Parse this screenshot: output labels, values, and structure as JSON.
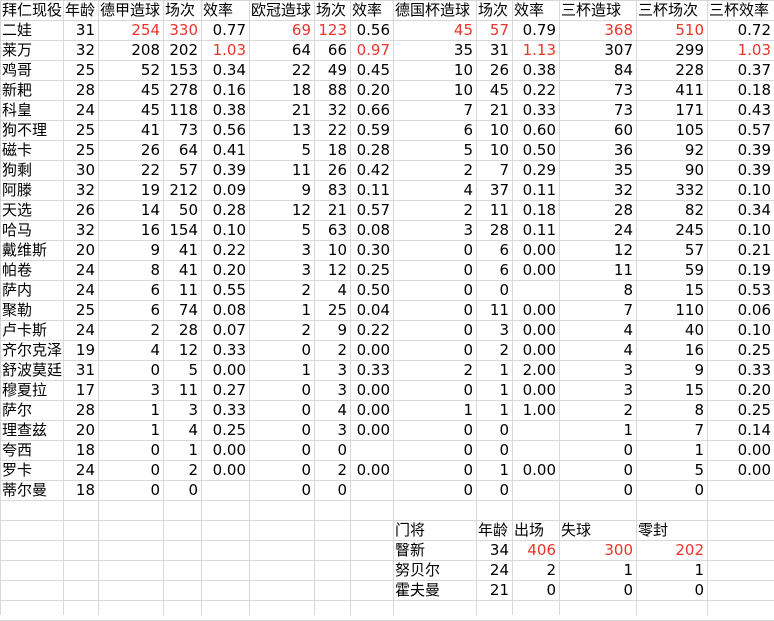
{
  "colors": {
    "highlight": "#e8352b",
    "grid": "#d8d8d8"
  },
  "header": [
    "拜仁现役",
    "年龄",
    "德甲造球",
    "场次",
    "效率",
    "欧冠造球",
    "场次",
    "效率",
    "德国杯造球",
    "场次",
    "效率",
    "三杯造球",
    "三杯场次",
    "三杯效率"
  ],
  "rows": [
    {
      "name": "二娃",
      "age": "31",
      "bl_g": "254",
      "bl_m": "330",
      "bl_e": "0.77",
      "cl_g": "69",
      "cl_m": "123",
      "cl_e": "0.56",
      "dfb_g": "45",
      "dfb_m": "57",
      "dfb_e": "0.79",
      "t_g": "368",
      "t_m": "510",
      "t_e": "0.72"
    },
    {
      "name": "莱万",
      "age": "32",
      "bl_g": "208",
      "bl_m": "202",
      "bl_e": "1.03",
      "cl_g": "64",
      "cl_m": "66",
      "cl_e": "0.97",
      "dfb_g": "35",
      "dfb_m": "31",
      "dfb_e": "1.13",
      "t_g": "307",
      "t_m": "299",
      "t_e": "1.03"
    },
    {
      "name": "鸡哥",
      "age": "25",
      "bl_g": "52",
      "bl_m": "153",
      "bl_e": "0.34",
      "cl_g": "22",
      "cl_m": "49",
      "cl_e": "0.45",
      "dfb_g": "10",
      "dfb_m": "26",
      "dfb_e": "0.38",
      "t_g": "84",
      "t_m": "228",
      "t_e": "0.37"
    },
    {
      "name": "新耙",
      "age": "28",
      "bl_g": "45",
      "bl_m": "278",
      "bl_e": "0.16",
      "cl_g": "18",
      "cl_m": "88",
      "cl_e": "0.20",
      "dfb_g": "10",
      "dfb_m": "45",
      "dfb_e": "0.22",
      "t_g": "73",
      "t_m": "411",
      "t_e": "0.18"
    },
    {
      "name": "科皇",
      "age": "24",
      "bl_g": "45",
      "bl_m": "118",
      "bl_e": "0.38",
      "cl_g": "21",
      "cl_m": "32",
      "cl_e": "0.66",
      "dfb_g": "7",
      "dfb_m": "21",
      "dfb_e": "0.33",
      "t_g": "73",
      "t_m": "171",
      "t_e": "0.43"
    },
    {
      "name": "狗不理",
      "age": "25",
      "bl_g": "41",
      "bl_m": "73",
      "bl_e": "0.56",
      "cl_g": "13",
      "cl_m": "22",
      "cl_e": "0.59",
      "dfb_g": "6",
      "dfb_m": "10",
      "dfb_e": "0.60",
      "t_g": "60",
      "t_m": "105",
      "t_e": "0.57"
    },
    {
      "name": "磁卡",
      "age": "25",
      "bl_g": "26",
      "bl_m": "64",
      "bl_e": "0.41",
      "cl_g": "5",
      "cl_m": "18",
      "cl_e": "0.28",
      "dfb_g": "5",
      "dfb_m": "10",
      "dfb_e": "0.50",
      "t_g": "36",
      "t_m": "92",
      "t_e": "0.39"
    },
    {
      "name": "狗剩",
      "age": "30",
      "bl_g": "22",
      "bl_m": "57",
      "bl_e": "0.39",
      "cl_g": "11",
      "cl_m": "26",
      "cl_e": "0.42",
      "dfb_g": "2",
      "dfb_m": "7",
      "dfb_e": "0.29",
      "t_g": "35",
      "t_m": "90",
      "t_e": "0.39"
    },
    {
      "name": "阿滕",
      "age": "32",
      "bl_g": "19",
      "bl_m": "212",
      "bl_e": "0.09",
      "cl_g": "9",
      "cl_m": "83",
      "cl_e": "0.11",
      "dfb_g": "4",
      "dfb_m": "37",
      "dfb_e": "0.11",
      "t_g": "32",
      "t_m": "332",
      "t_e": "0.10"
    },
    {
      "name": "天选",
      "age": "26",
      "bl_g": "14",
      "bl_m": "50",
      "bl_e": "0.28",
      "cl_g": "12",
      "cl_m": "21",
      "cl_e": "0.57",
      "dfb_g": "2",
      "dfb_m": "11",
      "dfb_e": "0.18",
      "t_g": "28",
      "t_m": "82",
      "t_e": "0.34"
    },
    {
      "name": "哈马",
      "age": "32",
      "bl_g": "16",
      "bl_m": "154",
      "bl_e": "0.10",
      "cl_g": "5",
      "cl_m": "63",
      "cl_e": "0.08",
      "dfb_g": "3",
      "dfb_m": "28",
      "dfb_e": "0.11",
      "t_g": "24",
      "t_m": "245",
      "t_e": "0.10"
    },
    {
      "name": "戴维斯",
      "age": "20",
      "bl_g": "9",
      "bl_m": "41",
      "bl_e": "0.22",
      "cl_g": "3",
      "cl_m": "10",
      "cl_e": "0.30",
      "dfb_g": "0",
      "dfb_m": "6",
      "dfb_e": "0.00",
      "t_g": "12",
      "t_m": "57",
      "t_e": "0.21"
    },
    {
      "name": "帕卷",
      "age": "24",
      "bl_g": "8",
      "bl_m": "41",
      "bl_e": "0.20",
      "cl_g": "3",
      "cl_m": "12",
      "cl_e": "0.25",
      "dfb_g": "0",
      "dfb_m": "6",
      "dfb_e": "0.00",
      "t_g": "11",
      "t_m": "59",
      "t_e": "0.19"
    },
    {
      "name": "萨内",
      "age": "24",
      "bl_g": "6",
      "bl_m": "11",
      "bl_e": "0.55",
      "cl_g": "2",
      "cl_m": "4",
      "cl_e": "0.50",
      "dfb_g": "0",
      "dfb_m": "0",
      "dfb_e": "",
      "t_g": "8",
      "t_m": "15",
      "t_e": "0.53"
    },
    {
      "name": "聚勒",
      "age": "25",
      "bl_g": "6",
      "bl_m": "74",
      "bl_e": "0.08",
      "cl_g": "1",
      "cl_m": "25",
      "cl_e": "0.04",
      "dfb_g": "0",
      "dfb_m": "11",
      "dfb_e": "0.00",
      "t_g": "7",
      "t_m": "110",
      "t_e": "0.06"
    },
    {
      "name": "卢卡斯",
      "age": "24",
      "bl_g": "2",
      "bl_m": "28",
      "bl_e": "0.07",
      "cl_g": "2",
      "cl_m": "9",
      "cl_e": "0.22",
      "dfb_g": "0",
      "dfb_m": "3",
      "dfb_e": "0.00",
      "t_g": "4",
      "t_m": "40",
      "t_e": "0.10"
    },
    {
      "name": "齐尔克泽",
      "age": "19",
      "bl_g": "4",
      "bl_m": "12",
      "bl_e": "0.33",
      "cl_g": "0",
      "cl_m": "2",
      "cl_e": "0.00",
      "dfb_g": "0",
      "dfb_m": "2",
      "dfb_e": "0.00",
      "t_g": "4",
      "t_m": "16",
      "t_e": "0.25"
    },
    {
      "name": "舒波莫廷",
      "age": "31",
      "bl_g": "0",
      "bl_m": "5",
      "bl_e": "0.00",
      "cl_g": "1",
      "cl_m": "3",
      "cl_e": "0.33",
      "dfb_g": "2",
      "dfb_m": "1",
      "dfb_e": "2.00",
      "t_g": "3",
      "t_m": "9",
      "t_e": "0.33"
    },
    {
      "name": "穆夏拉",
      "age": "17",
      "bl_g": "3",
      "bl_m": "11",
      "bl_e": "0.27",
      "cl_g": "0",
      "cl_m": "3",
      "cl_e": "0.00",
      "dfb_g": "0",
      "dfb_m": "1",
      "dfb_e": "0.00",
      "t_g": "3",
      "t_m": "15",
      "t_e": "0.20"
    },
    {
      "name": "萨尔",
      "age": "28",
      "bl_g": "1",
      "bl_m": "3",
      "bl_e": "0.33",
      "cl_g": "0",
      "cl_m": "4",
      "cl_e": "0.00",
      "dfb_g": "1",
      "dfb_m": "1",
      "dfb_e": "1.00",
      "t_g": "2",
      "t_m": "8",
      "t_e": "0.25"
    },
    {
      "name": "理查兹",
      "age": "20",
      "bl_g": "1",
      "bl_m": "4",
      "bl_e": "0.25",
      "cl_g": "0",
      "cl_m": "3",
      "cl_e": "0.00",
      "dfb_g": "0",
      "dfb_m": "0",
      "dfb_e": "",
      "t_g": "1",
      "t_m": "7",
      "t_e": "0.14"
    },
    {
      "name": "夸西",
      "age": "18",
      "bl_g": "0",
      "bl_m": "1",
      "bl_e": "0.00",
      "cl_g": "0",
      "cl_m": "0",
      "cl_e": "",
      "dfb_g": "0",
      "dfb_m": "0",
      "dfb_e": "",
      "t_g": "0",
      "t_m": "1",
      "t_e": "0.00"
    },
    {
      "name": "罗卡",
      "age": "24",
      "bl_g": "0",
      "bl_m": "2",
      "bl_e": "0.00",
      "cl_g": "0",
      "cl_m": "2",
      "cl_e": "0.00",
      "dfb_g": "0",
      "dfb_m": "1",
      "dfb_e": "0.00",
      "t_g": "0",
      "t_m": "5",
      "t_e": "0.00"
    },
    {
      "name": "蒂尔曼",
      "age": "18",
      "bl_g": "0",
      "bl_m": "0",
      "bl_e": "",
      "cl_g": "0",
      "cl_m": "0",
      "cl_e": "",
      "dfb_g": "0",
      "dfb_m": "0",
      "dfb_e": "",
      "t_g": "0",
      "t_m": "0",
      "t_e": ""
    }
  ],
  "gk": {
    "header": [
      "门将",
      "年龄",
      "出场",
      "失球",
      "零封"
    ],
    "rows": [
      {
        "name": "瞖新",
        "age": "34",
        "apps": "406",
        "conceded": "300",
        "clean": "202"
      },
      {
        "name": "努贝尔",
        "age": "24",
        "apps": "2",
        "conceded": "1",
        "clean": "1"
      },
      {
        "name": "霍夫曼",
        "age": "21",
        "apps": "0",
        "conceded": "0",
        "clean": "0"
      }
    ]
  }
}
